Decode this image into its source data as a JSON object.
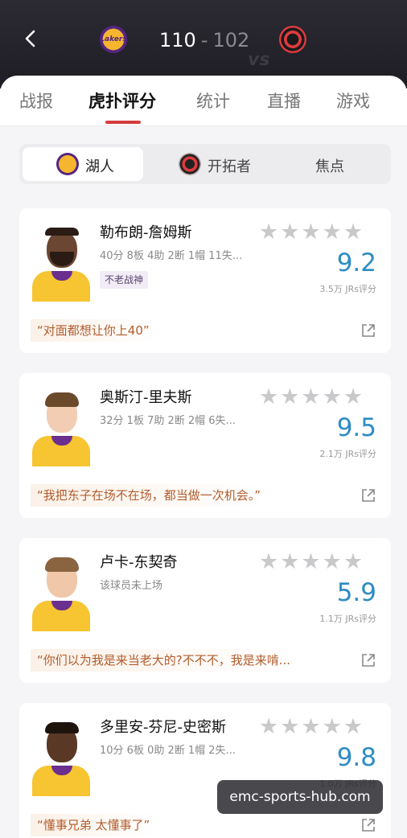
{
  "header": {
    "score_home": "110",
    "score_sep": "-",
    "score_away": "102",
    "home_logo_text": "Lakers",
    "vs_mark": "vs"
  },
  "tabs": [
    {
      "label": "战报",
      "active": false
    },
    {
      "label": "虎扑评分",
      "active": true
    },
    {
      "label": "统计",
      "active": false
    },
    {
      "label": "直播",
      "active": false
    },
    {
      "label": "游戏",
      "active": false
    }
  ],
  "segments": [
    {
      "label": "湖人",
      "active": true
    },
    {
      "label": "开拓者",
      "active": false
    },
    {
      "label": "焦点",
      "active": false
    }
  ],
  "players": [
    {
      "name": "勒布朗-詹姆斯",
      "stats": "40分 8板 4助 2断 1帽 11失...",
      "badge": "不老战神",
      "stars": "★★★★★",
      "rating": "9.2",
      "raters": "3.5万 JRs评分",
      "quote": "“对面都想让你上40”"
    },
    {
      "name": "奥斯汀-里夫斯",
      "stats": "32分 1板 7助 2断 2帽 6失...",
      "stars": "★★★★★",
      "rating": "9.5",
      "raters": "2.1万 JRs评分",
      "quote": "“我把东子在场不在场，都当做一次机会。”"
    },
    {
      "name": "卢卡-东契奇",
      "stats": "该球员未上场",
      "stars": "★★★★★",
      "rating": "5.9",
      "raters": "1.1万 JRs评分",
      "quote": "“你们以为我是来当老大的?不不不，我是来啃..."
    },
    {
      "name": "多里安-芬尼-史密斯",
      "stats": "10分 6板 0助 2断 1帽 2失...",
      "stars": "★★★★★",
      "rating": "9.8",
      "raters": "1.0万 JRs评分",
      "quote": "“懂事兄弟 太懂事了”"
    }
  ],
  "watermark": "emc-sports-hub.com",
  "colors": {
    "accent_red": "#d43c3c",
    "rating_blue": "#2e8cc4",
    "quote_text": "#b25c2c",
    "jersey_gold": "#f6c531",
    "lakers_purple": "#552583"
  }
}
